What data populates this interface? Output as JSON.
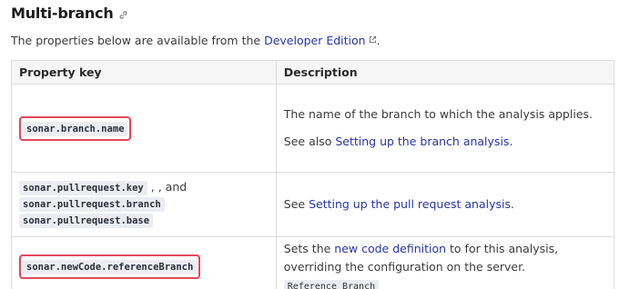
{
  "heading": {
    "title": "Multi-branch",
    "icon": "link-icon"
  },
  "intro": {
    "prefix": "The properties below are available from the ",
    "link": "Developer Edition",
    "suffix": "."
  },
  "table": {
    "headers": [
      "Property key",
      "Description"
    ],
    "row1": {
      "key": "sonar.branch.name",
      "desc1": "The name of the branch to which the analysis applies.",
      "see_prefix": "See also ",
      "see_link": "Setting up the branch analysis",
      "see_suffix": "."
    },
    "row2": {
      "key1": "sonar.pullrequest.key",
      "sep": ", , and",
      "key2": "sonar.pullrequest.branch",
      "key3": "sonar.pullrequest.base",
      "see_prefix": "See ",
      "see_link": "Setting up the pull request analysis",
      "see_suffix": "."
    },
    "row3": {
      "key": "sonar.newCode.referenceBranch",
      "desc_prefix": "Sets the ",
      "desc_link": "new code definition",
      "desc_suffix": " to  for this analysis,",
      "desc2": "overriding the configuration on the server.",
      "code": "Reference Branch"
    }
  },
  "colors": {
    "link": "#2636a6",
    "highlight": "#e5475d",
    "code_bg": "#ebedf2"
  }
}
